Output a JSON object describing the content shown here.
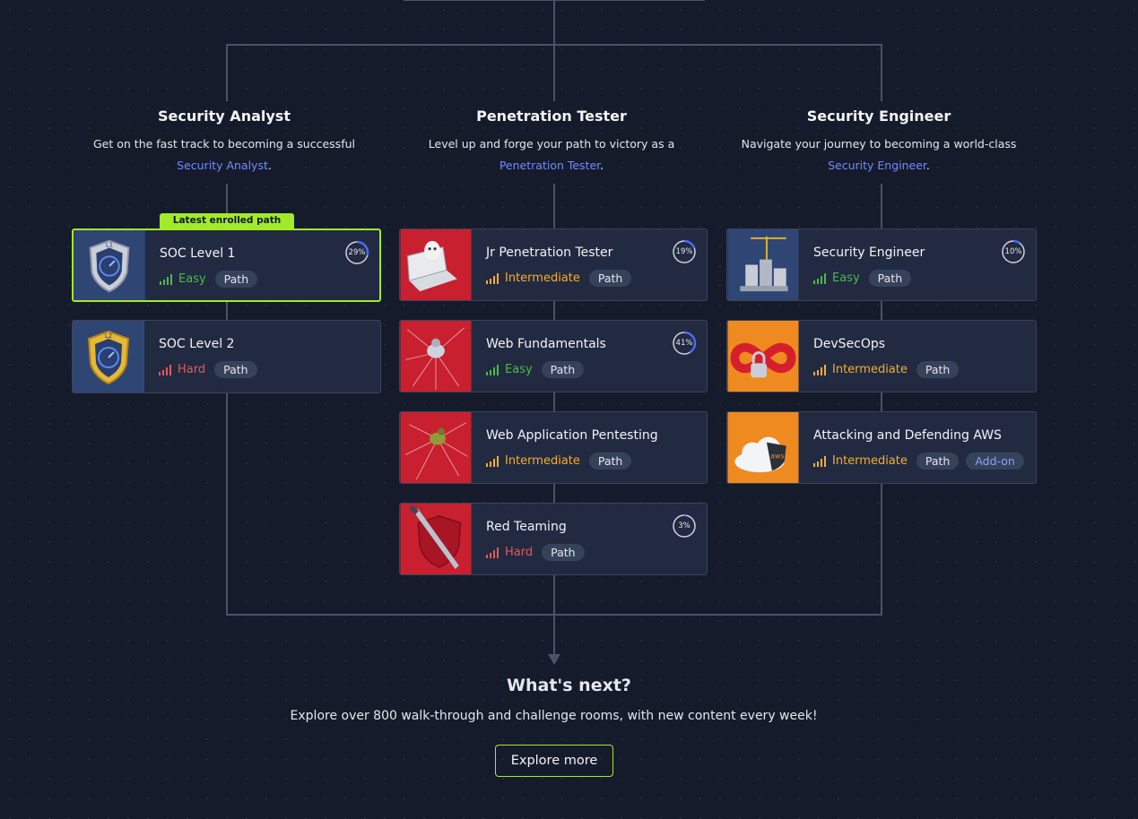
{
  "colors": {
    "accent": "#a3ea2a",
    "link": "#6e8cff",
    "easy": "#4fb84a",
    "intermediate": "#f6ae2d",
    "hard": "#e05a5a"
  },
  "columns": [
    {
      "title": "Security Analyst",
      "desc_line1": "Get on the fast track to becoming a successful",
      "link": "Security Analyst",
      "suffix": "."
    },
    {
      "title": "Penetration Tester",
      "desc_line1": "Level up and forge your path to victory as a",
      "link": "Penetration Tester",
      "suffix": "."
    },
    {
      "title": "Security Engineer",
      "desc_line1": "Navigate your journey to becoming a world-class",
      "link": "Security Engineer",
      "suffix": "."
    }
  ],
  "badge": "Latest enrolled path",
  "cards": {
    "soc1": {
      "title": "SOC Level 1",
      "difficulty": "Easy",
      "type": "Path",
      "progress_label": "29%",
      "progress": 29,
      "icon": "shield-l1-icon"
    },
    "soc2": {
      "title": "SOC Level 2",
      "difficulty": "Hard",
      "type": "Path",
      "icon": "shield-l2-icon"
    },
    "jrpt": {
      "title": "Jr Penetration Tester",
      "difficulty": "Intermediate",
      "type": "Path",
      "progress_label": "19%",
      "progress": 19,
      "icon": "laptop-icon"
    },
    "webfund": {
      "title": "Web Fundamentals",
      "difficulty": "Easy",
      "type": "Path",
      "progress_label": "41%",
      "progress": 41,
      "icon": "spider-icon"
    },
    "webapp": {
      "title": "Web Application Pentesting",
      "difficulty": "Intermediate",
      "type": "Path",
      "icon": "spider-web-icon"
    },
    "redteam": {
      "title": "Red Teaming",
      "difficulty": "Hard",
      "type": "Path",
      "progress_label": "3%",
      "progress": 3,
      "icon": "dagger-shield-icon"
    },
    "seceng": {
      "title": "Security Engineer",
      "difficulty": "Easy",
      "type": "Path",
      "progress_label": "10%",
      "progress": 10,
      "icon": "server-crane-icon"
    },
    "devsecops": {
      "title": "DevSecOps",
      "difficulty": "Intermediate",
      "type": "Path",
      "icon": "infinity-lock-icon"
    },
    "aws": {
      "title": "Attacking and Defending AWS",
      "difficulty": "Intermediate",
      "type": "Path",
      "addon": "Add-on",
      "icon": "aws-cloud-icon"
    }
  },
  "next": {
    "title": "What's next?",
    "desc": "Explore over 800 walk-through and challenge rooms, with new content every week!",
    "button": "Explore more"
  }
}
